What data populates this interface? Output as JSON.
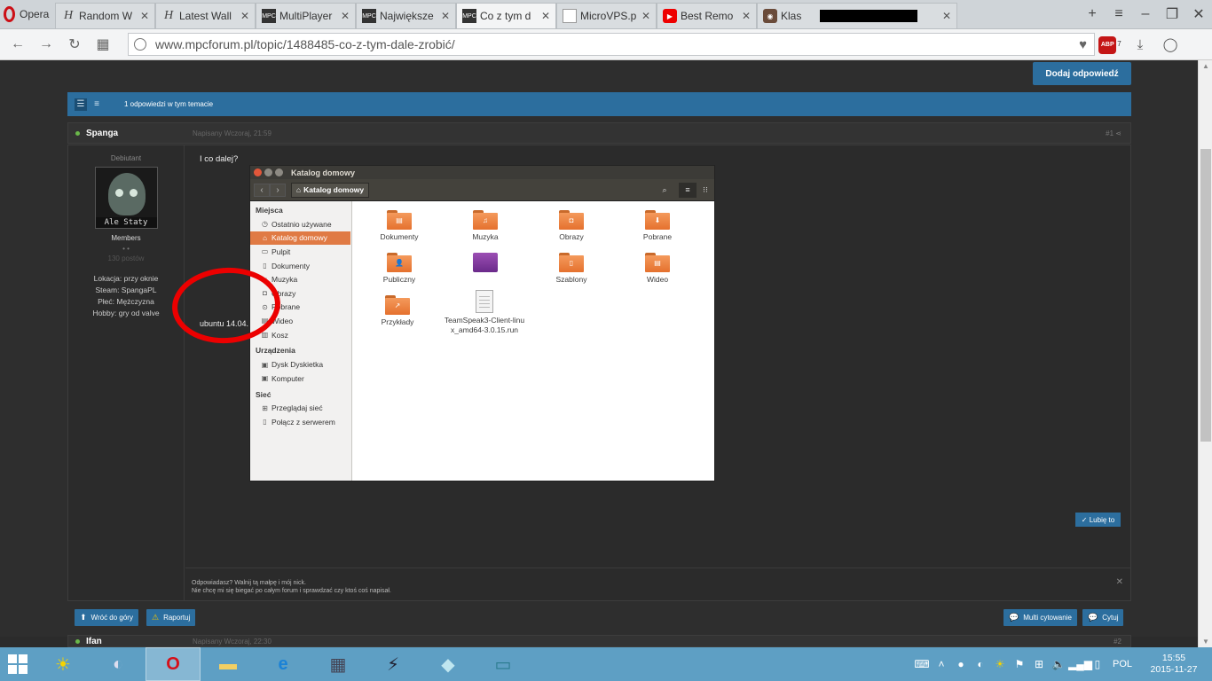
{
  "browser": {
    "menu_label": "Opera",
    "tabs": [
      {
        "title": "Random W",
        "icon": "h-icon"
      },
      {
        "title": "Latest Wall",
        "icon": "h-icon"
      },
      {
        "title": "MultiPlayer",
        "icon": "mpc-icon"
      },
      {
        "title": "Największe",
        "icon": "mpc-icon"
      },
      {
        "title": "Co z tym d",
        "icon": "mpc-icon",
        "active": true
      },
      {
        "title": "MicroVPS.p",
        "icon": "page-icon"
      },
      {
        "title": "Best Remo",
        "icon": "youtube-icon"
      },
      {
        "title": "Klas",
        "icon": "instagram-icon"
      },
      {
        "title": "",
        "icon": "page-icon"
      }
    ],
    "url": "www.mpcforum.pl/topic/1488485-co-z-tym-dale-zrobić/",
    "abp_badge": "ABP",
    "abp_count": "7"
  },
  "forum": {
    "reply_button": "Dodaj odpowiedź",
    "topic_bar_text": "1 odpowiedzi w tym temacie",
    "post": {
      "author": "Spanga",
      "date": "Napisany Wczoraj, 21:59",
      "number": "#1",
      "rank": "Debiutant",
      "avatar_caption": "Ale Staty",
      "group": "Members",
      "pips": "• •",
      "post_count": "130 postów",
      "info": [
        "Lokacja: przy oknie",
        "Steam: SpangaPL",
        "Płeć: Mężczyzna",
        "Hobby: gry od valve"
      ],
      "text": "I co dalej?",
      "text2": "ubuntu 14.04.",
      "like_button": "✓ Lubię to",
      "signature_line1": "Odpowiadasz? Walnij tą małpę i mój nick.",
      "signature_line2": "Nie chcę mi się biegać po całym forum i sprawdzać czy ktoś coś napisał."
    },
    "footer": {
      "back_to_top": "Wróć do góry",
      "report": "Raportuj",
      "multiquote": "Multi cytowanie",
      "quote": "Cytuj"
    },
    "next_post": {
      "author": "Ifan",
      "date": "Napisany Wczoraj, 22:30",
      "number": "#2"
    }
  },
  "nautilus": {
    "window_title": "Katalog domowy",
    "breadcrumb": "Katalog domowy",
    "sidebar": {
      "places_header": "Miejsca",
      "places": [
        {
          "label": "Ostatnio używane",
          "icon": "clock-icon"
        },
        {
          "label": "Katalog domowy",
          "icon": "home-icon",
          "selected": true
        },
        {
          "label": "Pulpit",
          "icon": "folder-icon"
        },
        {
          "label": "Dokumenty",
          "icon": "document-icon"
        },
        {
          "label": "Muzyka",
          "icon": "music-icon"
        },
        {
          "label": "Obrazy",
          "icon": "camera-icon"
        },
        {
          "label": "Pobrane",
          "icon": "download-icon"
        },
        {
          "label": "Wideo",
          "icon": "film-icon"
        },
        {
          "label": "Kosz",
          "icon": "trash-icon"
        }
      ],
      "devices_header": "Urządzenia",
      "devices": [
        {
          "label": "Dysk Dyskietka",
          "icon": "floppy-icon"
        },
        {
          "label": "Komputer",
          "icon": "computer-icon"
        }
      ],
      "network_header": "Sieć",
      "network": [
        {
          "label": "Przeglądaj sieć",
          "icon": "network-icon"
        },
        {
          "label": "Połącz z serwerem",
          "icon": "server-icon"
        }
      ]
    },
    "files": [
      {
        "label": "Dokumenty",
        "kind": "folder"
      },
      {
        "label": "Muzyka",
        "kind": "folder"
      },
      {
        "label": "Obrazy",
        "kind": "folder"
      },
      {
        "label": "Pobrane",
        "kind": "folder"
      },
      {
        "label": "Publiczny",
        "kind": "folder"
      },
      {
        "label": "",
        "kind": "purple"
      },
      {
        "label": "Szablony",
        "kind": "folder"
      },
      {
        "label": "Wideo",
        "kind": "folder"
      },
      {
        "label": "Przykłady",
        "kind": "folder"
      },
      {
        "label": "TeamSpeak3-Client-linux_amd64-3.0.15.run",
        "kind": "file"
      }
    ]
  },
  "taskbar": {
    "language": "POL",
    "time": "15:55",
    "date": "2015-11-27"
  },
  "colors": {
    "accent": "#2c6e9e",
    "ubuntu_orange": "#e07a44",
    "annotation_red": "#ec0000",
    "taskbar": "#5e9fc4"
  }
}
